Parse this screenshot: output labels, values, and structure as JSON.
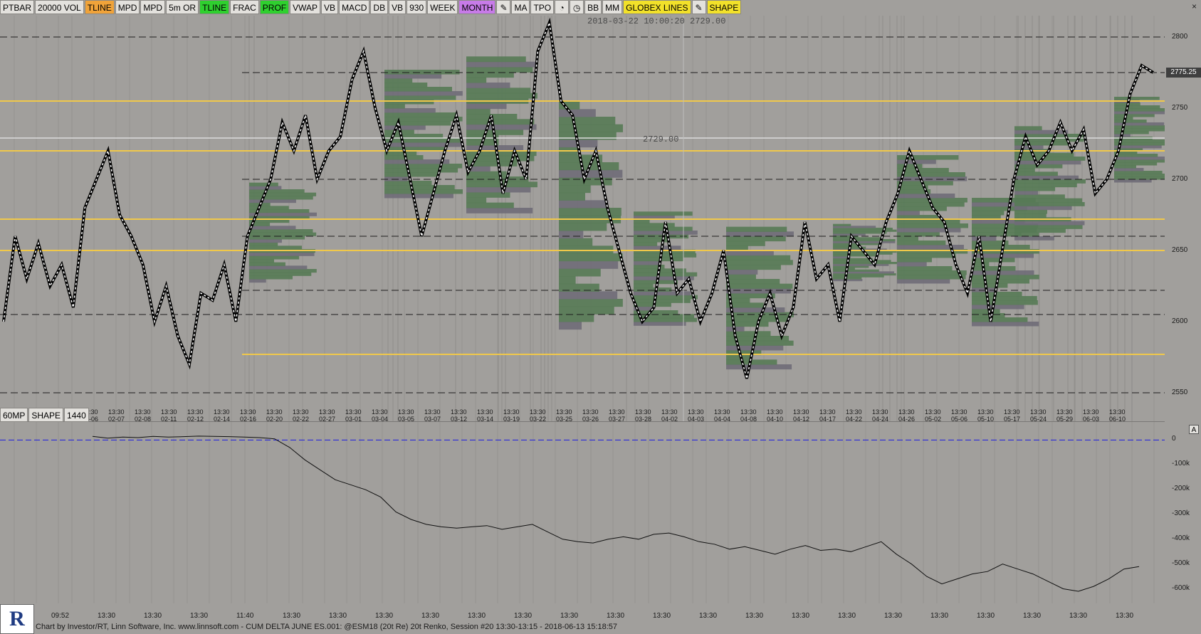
{
  "toolbar": [
    {
      "label": "PTBAR",
      "bg": "#e3e1dd"
    },
    {
      "label": "20000 VOL",
      "bg": "#e3e1dd"
    },
    {
      "label": "TLINE",
      "bg": "#f0a33a"
    },
    {
      "label": "MPD",
      "bg": "#e3e1dd"
    },
    {
      "label": "MPD",
      "bg": "#e3e1dd"
    },
    {
      "label": "5m OR",
      "bg": "#e3e1dd"
    },
    {
      "label": "TLINE",
      "bg": "#2fd02f"
    },
    {
      "label": "FRAC",
      "bg": "#e3e1dd"
    },
    {
      "label": "PROF",
      "bg": "#2fd02f"
    },
    {
      "label": "VWAP",
      "bg": "#e3e1dd"
    },
    {
      "label": "VB",
      "bg": "#e3e1dd"
    },
    {
      "label": "MACD",
      "bg": "#e3e1dd"
    },
    {
      "label": "DB",
      "bg": "#e3e1dd"
    },
    {
      "label": "VB",
      "bg": "#e3e1dd"
    },
    {
      "label": "930",
      "bg": "#e3e1dd"
    },
    {
      "label": "WEEK",
      "bg": "#e3e1dd"
    },
    {
      "label": "MONTH",
      "bg": "#c77be8"
    },
    {
      "label": "✎",
      "bg": "#e3e1dd",
      "icon": "pencil-icon"
    },
    {
      "label": "MA",
      "bg": "#e3e1dd"
    },
    {
      "label": "TPO",
      "bg": "#e3e1dd"
    },
    {
      "label": "◔",
      "bg": "#e3e1dd",
      "icon": "pie-icon"
    },
    {
      "label": "◷",
      "bg": "#e3e1dd",
      "icon": "clock-icon"
    },
    {
      "label": "BB",
      "bg": "#e3e1dd"
    },
    {
      "label": "MM",
      "bg": "#e3e1dd"
    },
    {
      "label": "GLOBEX LINES",
      "bg": "#f2e12a"
    },
    {
      "label": "✎",
      "bg": "#e3e1dd",
      "icon": "pencil-icon"
    },
    {
      "label": "SHAPE",
      "bg": "#f2e12a"
    }
  ],
  "panel_buttons": [
    "60MP",
    "SHAPE",
    "1440"
  ],
  "crosshair_info": "2018-03-22 10:00:20  2729.00",
  "ref_level_label": "2729.00",
  "last_price": "2775.25",
  "price_axis": [
    "2800",
    "2750",
    "2700",
    "2650",
    "2600",
    "2550"
  ],
  "lower_axis": [
    "0",
    "-100k",
    "-200k",
    "-300k",
    "-400k",
    "-500k",
    "-600k"
  ],
  "pane_marker": "A",
  "close_mark": "×",
  "date_labels": [
    [
      "13:30",
      "02-06"
    ],
    [
      "13:30",
      "02-07"
    ],
    [
      "13:30",
      "02-08"
    ],
    [
      "13:30",
      "02-11"
    ],
    [
      "13:30",
      "02-12"
    ],
    [
      "13:30",
      "02-14"
    ],
    [
      "13:30",
      "02-16"
    ],
    [
      "13:30",
      "02-20"
    ],
    [
      "13:30",
      "02-22"
    ],
    [
      "13:30",
      "02-27"
    ],
    [
      "13:30",
      "03-01"
    ],
    [
      "13:30",
      "03-04"
    ],
    [
      "13:30",
      "03-05"
    ],
    [
      "13:30",
      "03-07"
    ],
    [
      "13:30",
      "03-12"
    ],
    [
      "13:30",
      "03-14"
    ],
    [
      "13:30",
      "03-19"
    ],
    [
      "13:30",
      "03-22"
    ],
    [
      "13:30",
      "03-25"
    ],
    [
      "13:30",
      "03-26"
    ],
    [
      "13:30",
      "03-27"
    ],
    [
      "13:30",
      "03-28"
    ],
    [
      "13:30",
      "04-02"
    ],
    [
      "13:30",
      "04-03"
    ],
    [
      "13:30",
      "04-04"
    ],
    [
      "13:30",
      "04-08"
    ],
    [
      "13:30",
      "04-10"
    ],
    [
      "13:30",
      "04-12"
    ],
    [
      "13:30",
      "04-17"
    ],
    [
      "13:30",
      "04-22"
    ],
    [
      "13:30",
      "04-24"
    ],
    [
      "13:30",
      "04-26"
    ],
    [
      "13:30",
      "05-02"
    ],
    [
      "13:30",
      "05-06"
    ],
    [
      "13:30",
      "05-10"
    ],
    [
      "13:30",
      "05-17"
    ],
    [
      "13:30",
      "05-24"
    ],
    [
      "13:30",
      "05-29"
    ],
    [
      "13:30",
      "06-03"
    ],
    [
      "13:30",
      "06-10"
    ]
  ],
  "time_axis": [
    "09:52",
    "13:30",
    "13:30",
    "13:30",
    "11:40",
    "13:30",
    "13:30",
    "13:30",
    "13:30",
    "13:30",
    "13:30",
    "13:30",
    "13:30",
    "13:30",
    "13:30",
    "13:30",
    "13:30",
    "13:30",
    "13:30",
    "13:30",
    "13:30",
    "13:30",
    "13:30",
    "13:30"
  ],
  "status_text": "Chart by Investor/RT, Linn Software, Inc. www.linnsoft.com - CUM DELTA JUNE ES.001: @ESM18 (20t Re) 20t Renko, Session #20 13:30-13:15 - 2018-06-13 15:18:57",
  "logo_text": "R",
  "colors": {
    "background": "#a19f9c",
    "profile_green": "#567a55",
    "profile_gray": "#6f6c78",
    "level_yellow": "#f0c84a",
    "zero_line": "#2b2bd8",
    "grid": "#8e8c89"
  },
  "chart_data": [
    {
      "type": "line",
      "title": "",
      "ylabel": "",
      "ylim": [
        2550,
        2810
      ],
      "series": [
        {
          "values": [
            2600,
            2660,
            2630,
            2655,
            2625,
            2640,
            2610,
            2680,
            2700,
            2720,
            2675,
            2660,
            2640,
            2600,
            2625,
            2590,
            2570,
            2620,
            2615,
            2640,
            2600,
            2660,
            2680,
            2700,
            2740,
            2720,
            2745,
            2700,
            2720,
            2730,
            2770,
            2790,
            2750,
            2720,
            2740,
            2700,
            2660,
            2690,
            2720,
            2745,
            2705,
            2720,
            2745,
            2690,
            2720,
            2700,
            2790,
            2810,
            2755,
            2745,
            2700,
            2720,
            2680,
            2650,
            2620,
            2600,
            2610,
            2670,
            2620,
            2630,
            2600,
            2620,
            2650,
            2590,
            2560,
            2600,
            2620,
            2590,
            2610,
            2670,
            2630,
            2640,
            2600,
            2660,
            2650,
            2640,
            2670,
            2690,
            2720,
            2700,
            2680,
            2670,
            2640,
            2620,
            2660,
            2600,
            2650,
            2700,
            2730,
            2710,
            2720,
            2740,
            2720,
            2735,
            2690,
            2700,
            2720,
            2760,
            2780,
            2775
          ]
        }
      ],
      "reference_levels": [
        2800,
        2775,
        2755,
        2729,
        2720,
        2700,
        2672,
        2660,
        2650,
        2622,
        2605,
        2577,
        2550
      ]
    },
    {
      "type": "line",
      "title": "",
      "ylabel": "",
      "ylim": [
        -630000,
        30000
      ],
      "series": [
        {
          "values": [
            15000,
            8000,
            12000,
            10000,
            15000,
            12000,
            14000,
            16000,
            15000,
            14000,
            12000,
            10000,
            5000,
            -30000,
            -80000,
            -120000,
            -160000,
            -180000,
            -200000,
            -230000,
            -290000,
            -320000,
            -340000,
            -350000,
            -355000,
            -350000,
            -345000,
            -360000,
            -350000,
            -340000,
            -370000,
            -400000,
            -410000,
            -415000,
            -400000,
            -390000,
            -400000,
            -380000,
            -375000,
            -390000,
            -410000,
            -420000,
            -440000,
            -430000,
            -445000,
            -460000,
            -440000,
            -425000,
            -445000,
            -440000,
            -450000,
            -430000,
            -410000,
            -460000,
            -500000,
            -550000,
            -580000,
            -560000,
            -540000,
            -530000,
            -500000,
            -520000,
            -540000,
            -570000,
            -600000,
            -610000,
            -590000,
            -560000,
            -520000,
            -510000
          ]
        }
      ],
      "reference_levels": [
        0
      ]
    }
  ]
}
